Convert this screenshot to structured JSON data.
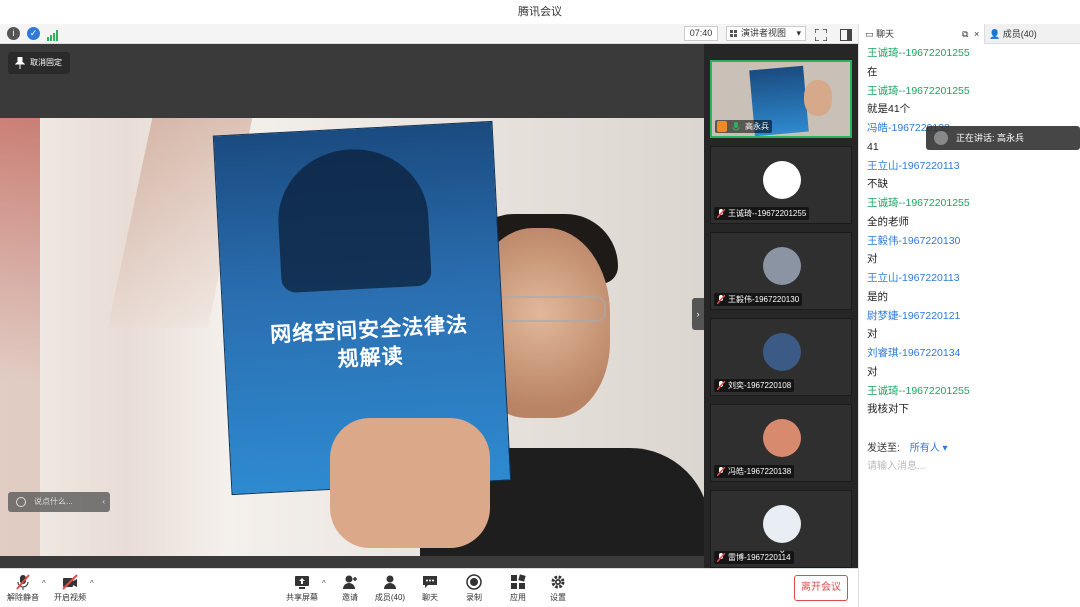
{
  "window": {
    "title": "腾讯会议"
  },
  "top_toolbar": {
    "time": "07:40",
    "view_mode": "演讲者视图"
  },
  "stage": {
    "unpin_label": "取消固定",
    "chat_placeholder": "说点什么...",
    "book_title": "网络空间安全法律法规解读"
  },
  "speaking": {
    "label": "正在讲话: 高永兵"
  },
  "participants": [
    {
      "name": "高永兵",
      "color": "#c9c0b8",
      "active": true
    },
    {
      "name": "王诚琦--19672201255",
      "color": "#ffffff"
    },
    {
      "name": "王毅伟-1967220130",
      "color": "#8a94a3"
    },
    {
      "name": "刘奕-1967220108",
      "color": "#3b5b86"
    },
    {
      "name": "冯皓-1967220138",
      "color": "#d88a6e"
    },
    {
      "name": "雷博-1967220114",
      "color": "#e9eef4"
    }
  ],
  "right_panel": {
    "chat_tab": "聊天",
    "members_tab": "成员(40)",
    "messages": [
      {
        "name": "王诚琦--19672201255",
        "color": "green",
        "text": "在"
      },
      {
        "name": "王诚琦--19672201255",
        "color": "green",
        "text": "就是41个"
      },
      {
        "name": "冯皓-1967220138",
        "color": "blue",
        "text": "41"
      },
      {
        "name": "王立山-1967220113",
        "color": "blue",
        "text": "不缺"
      },
      {
        "name": "王诚琦--19672201255",
        "color": "green",
        "text": "全的老师"
      },
      {
        "name": "王毅伟-1967220130",
        "color": "blue",
        "text": "对"
      },
      {
        "name": "王立山-1967220113",
        "color": "blue",
        "text": "是的"
      },
      {
        "name": "尉梦婕-1967220121",
        "color": "blue",
        "text": "对"
      },
      {
        "name": "刘睿琪-1967220134",
        "color": "blue",
        "text": "对"
      },
      {
        "name": "王诚琦--19672201255",
        "color": "green",
        "text": "我核对下"
      }
    ],
    "send_to_label": "发送至:",
    "send_to_value": "所有人 ▾",
    "input_placeholder": "请输入消息..."
  },
  "bottom_bar": {
    "unmute": "解除静音",
    "start_video": "开启视频",
    "share_screen": "共享屏幕",
    "invite": "邀请",
    "members": "成员(40)",
    "chat": "聊天",
    "record": "录制",
    "apps": "应用",
    "settings": "设置",
    "leave": "离开会议"
  },
  "colors": {
    "accent_green": "#1fa35f",
    "accent_blue": "#2f7ad8",
    "leave_red": "#e14b4b"
  }
}
